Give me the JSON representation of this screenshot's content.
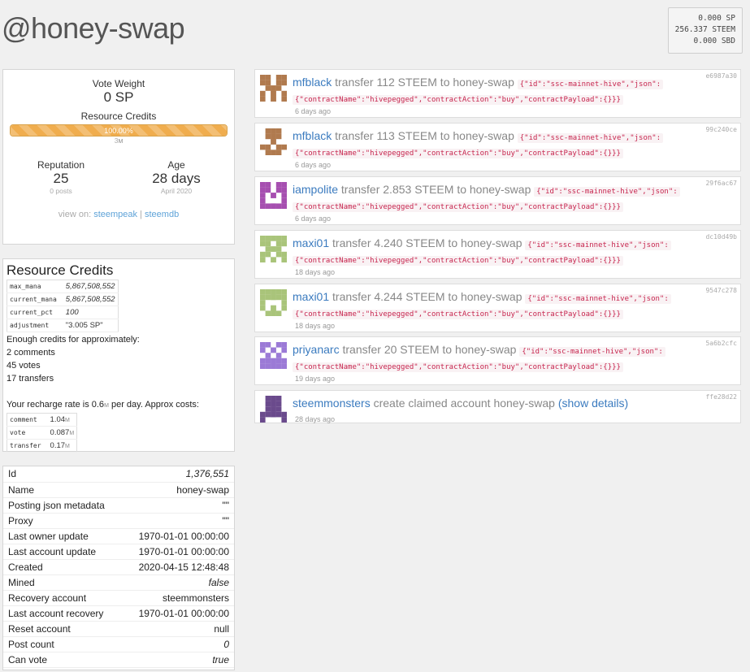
{
  "account": {
    "title": "@honey-swap"
  },
  "balances": {
    "sp": "0.000 SP",
    "steem": "256.337 STEEM",
    "sbd": "0.000 SBD"
  },
  "summary": {
    "vote_weight_label": "Vote Weight",
    "vote_weight": "0 SP",
    "rc_label": "Resource Credits",
    "rc_percent_text": "100.00%",
    "rc_percent": 1.0,
    "rc_amount": "3",
    "rc_unit": "M",
    "reputation_label": "Reputation",
    "reputation": "25",
    "posts": "0 posts",
    "age_label": "Age",
    "age": "28 days",
    "age_since": "April 2020",
    "view_on": "view on:",
    "link1": "steempeak",
    "sep": "|",
    "link2": "steemdb"
  },
  "rc": {
    "title": "Resource Credits",
    "rows": [
      {
        "k": "max_mana",
        "v": "5,867,508,552"
      },
      {
        "k": "current_mana",
        "v": "5,867,508,552"
      },
      {
        "k": "current_pct",
        "v": "100"
      },
      {
        "k": "adjustment",
        "v": "\"3.005 SP\""
      }
    ],
    "enough": "Enough credits for approximately:",
    "comments": "2 comments",
    "votes": "45 votes",
    "transfers": "17 transfers",
    "recharge_pre": "Your recharge rate is 0.6",
    "recharge_unit": "M",
    "recharge_post": " per day. Approx costs:",
    "costs": [
      {
        "k": "comment",
        "v": "1.04",
        "u": "M"
      },
      {
        "k": "vote",
        "v": "0.087",
        "u": "M"
      },
      {
        "k": "transfer",
        "v": "0.17",
        "u": "M"
      }
    ]
  },
  "props": [
    {
      "k": "Id",
      "v": "1,376,551",
      "italic": true
    },
    {
      "k": "Name",
      "v": "honey-swap",
      "italic": false
    },
    {
      "k": "Posting json metadata",
      "v": "\"\"",
      "italic": false
    },
    {
      "k": "Proxy",
      "v": "\"\"",
      "italic": false
    },
    {
      "k": "Last owner update",
      "v": "1970-01-01 00:00:00",
      "italic": false
    },
    {
      "k": "Last account update",
      "v": "1970-01-01 00:00:00",
      "italic": false
    },
    {
      "k": "Created",
      "v": "2020-04-15 12:48:48",
      "italic": false
    },
    {
      "k": "Mined",
      "v": "false",
      "italic": true
    },
    {
      "k": "Recovery account",
      "v": "steemmonsters",
      "italic": false
    },
    {
      "k": "Last account recovery",
      "v": "1970-01-01 00:00:00",
      "italic": false
    },
    {
      "k": "Reset account",
      "v": "null",
      "italic": false
    },
    {
      "k": "Post count",
      "v": "0",
      "italic": true
    },
    {
      "k": "Can vote",
      "v": "true",
      "italic": true
    }
  ],
  "feed": [
    {
      "user": "mfblack",
      "action": "transfer 112 STEEM to honey-swap",
      "json1": "{\"id\":\"ssc-mainnet-hive\",\"json\":",
      "json2": "{\"contractName\":\"hivepegged\",\"contractAction\":\"buy\",\"contractPayload\":{}}}",
      "ago": "6 days ago",
      "hash": "e6987a30",
      "color": "#b07a4e"
    },
    {
      "user": "mfblack",
      "action": "transfer 113 STEEM to honey-swap",
      "json1": "{\"id\":\"ssc-mainnet-hive\",\"json\":",
      "json2": "{\"contractName\":\"hivepegged\",\"contractAction\":\"buy\",\"contractPayload\":{}}}",
      "ago": "6 days ago",
      "hash": "99c240ce",
      "color": "#b07a4e"
    },
    {
      "user": "iampolite",
      "action": "transfer 2.853 STEEM to honey-swap",
      "json1": "{\"id\":\"ssc-mainnet-hive\",\"json\":",
      "json2": "{\"contractName\":\"hivepegged\",\"contractAction\":\"buy\",\"contractPayload\":{}}}",
      "ago": "6 days ago",
      "hash": "29f6ac67",
      "color": "#a64fb0"
    },
    {
      "user": "maxi01",
      "action": "transfer 4.240 STEEM to honey-swap",
      "json1": "{\"id\":\"ssc-mainnet-hive\",\"json\":",
      "json2": "{\"contractName\":\"hivepegged\",\"contractAction\":\"buy\",\"contractPayload\":{}}}",
      "ago": "18 days ago",
      "hash": "dc10d49b",
      "color": "#a9c47a"
    },
    {
      "user": "maxi01",
      "action": "transfer 4.244 STEEM to honey-swap",
      "json1": "{\"id\":\"ssc-mainnet-hive\",\"json\":",
      "json2": "{\"contractName\":\"hivepegged\",\"contractAction\":\"buy\",\"contractPayload\":{}}}",
      "ago": "18 days ago",
      "hash": "9547c278",
      "color": "#a9c47a"
    },
    {
      "user": "priyanarc",
      "action": "transfer 20 STEEM to honey-swap",
      "json1": "{\"id\":\"ssc-mainnet-hive\",\"json\":",
      "json2": "{\"contractName\":\"hivepegged\",\"contractAction\":\"buy\",\"contractPayload\":{}}}",
      "ago": "19 days ago",
      "hash": "5a6b2cfc",
      "color": "#9b7ad6"
    },
    {
      "user": "steemmonsters",
      "action": "create claimed account honey-swap",
      "details": "(show details)",
      "ago": "28 days ago",
      "hash": "ffe28d22",
      "color": "#6a4a8c"
    }
  ]
}
